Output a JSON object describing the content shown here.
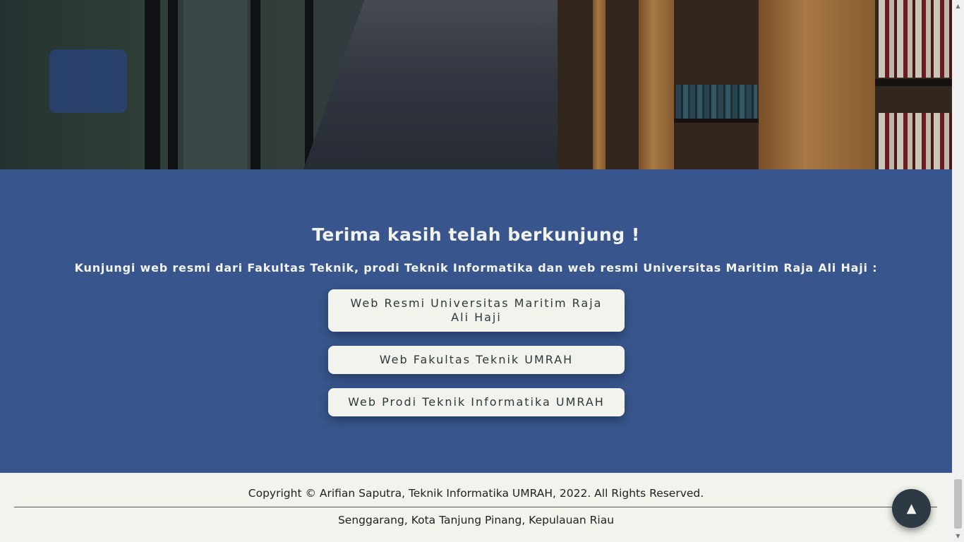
{
  "thanks": {
    "title": "Terima kasih telah berkunjung !",
    "subtitle": "Kunjungi web resmi dari Fakultas Teknik, prodi Teknik Informatika dan web resmi Universitas Maritim Raja Ali Haji :",
    "links": [
      {
        "label": "Web Resmi Universitas Maritim Raja Ali Haji"
      },
      {
        "label": "Web Fakultas Teknik UMRAH"
      },
      {
        "label": "Web Prodi Teknik Informatika UMRAH"
      }
    ]
  },
  "footer": {
    "copyright": "Copyright © Arifian Saputra, Teknik Informatika UMRAH, 2022. All Rights Reserved.",
    "address": "Senggarang, Kota Tanjung Pinang, Kepulauan Riau"
  },
  "back_to_top": {
    "icon": "▲"
  },
  "scrollbar": {
    "up_icon": "▲",
    "down_icon": "▼"
  },
  "colors": {
    "section_bg": "#38568d",
    "button_bg": "#f1f3ec",
    "footer_bg": "#f1f3ec",
    "back_to_top_bg": "#2d3a44"
  }
}
